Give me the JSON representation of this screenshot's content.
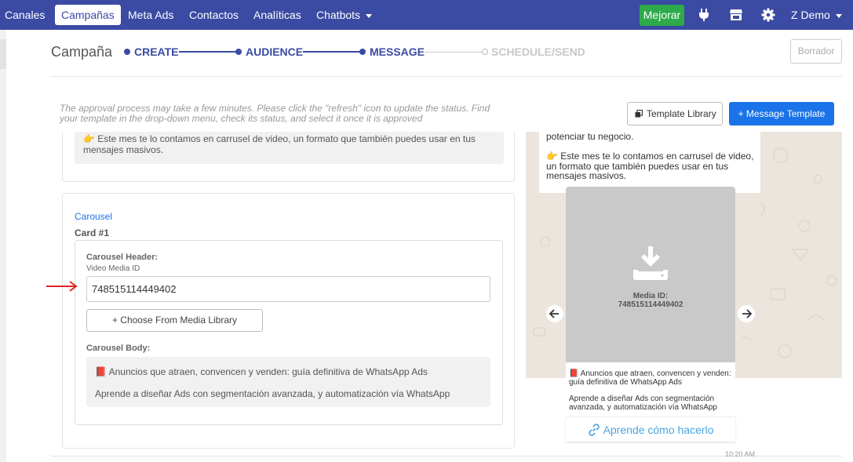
{
  "nav": {
    "items": [
      "Canales",
      "Campañas",
      "Meta Ads",
      "Contactos",
      "Analíticas",
      "Chatbots"
    ],
    "upgrade_label": "Mejorar",
    "user_label": "Z Demo",
    "icons": [
      "plug-icon",
      "store-icon",
      "gear-icon"
    ],
    "accent": "#3b4aa3"
  },
  "page": {
    "title": "Campaña",
    "steps": [
      "CREATE",
      "AUDIENCE",
      "MESSAGE",
      "SCHEDULE/SEND"
    ],
    "draft_label": "Borrador",
    "approval_note": "The approval process may take a few minutes. Please click the \"refresh\" icon to update the status. Find your template in the drop-down menu, check its status, and select it once it is approved",
    "template_library_label": "Template Library",
    "message_template_label": "+ Message Template"
  },
  "form": {
    "prev_text": "👉 Este mes te lo contamos en carrusel de video, un formato que también puedes usar en tus mensajes masivos.",
    "carousel_link": "Carousel",
    "card_title": "Card #1",
    "header_label": "Carousel Header:",
    "media_id_label": "Video Media ID",
    "media_id_value": "748515114449402",
    "choose_label": "+ Choose From Media Library",
    "body_label": "Carousel Body:",
    "body_line1": "📕 Anuncios que atraen, convencen y venden: guía definitiva de WhatsApp Ads",
    "body_line2": "Aprende a diseñar Ads con segmentación avanzada, y automatización vía WhatsApp"
  },
  "preview": {
    "line0": "potenciar tu negocio.",
    "line1": "👉 Este mes te lo contamos en carrusel de video,",
    "line2": "un formato que también puedes usar en tus",
    "line3": "mensajes masivos.",
    "media_label": "Media ID:",
    "media_value": "748515114449402",
    "card_line1": "📕 Anuncios que atraen, convencen y venden:",
    "card_line2": "guía definitiva de WhatsApp Ads",
    "card_line3": "Aprende a diseñar Ads con segmentación",
    "card_line4": "avanzada, y automatización vía WhatsApp",
    "button_label": "Aprende cómo hacerlo",
    "time": "10:20 AM"
  }
}
